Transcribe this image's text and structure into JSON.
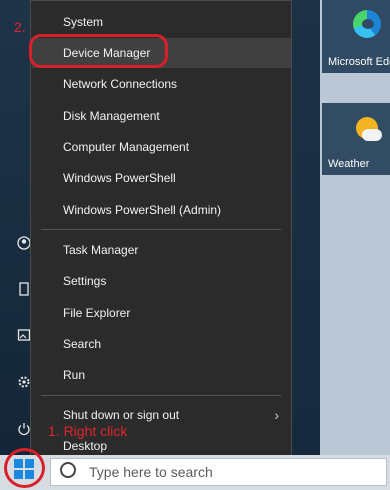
{
  "start_menu": {
    "items": [
      {
        "label": "System"
      },
      {
        "label": "Device Manager"
      },
      {
        "label": "Network Connections"
      },
      {
        "label": "Disk Management"
      },
      {
        "label": "Computer Management"
      },
      {
        "label": "Windows PowerShell"
      },
      {
        "label": "Windows PowerShell (Admin)"
      },
      {
        "label": "Task Manager"
      },
      {
        "label": "Settings"
      },
      {
        "label": "File Explorer"
      },
      {
        "label": "Search"
      },
      {
        "label": "Run"
      },
      {
        "label": "Shut down or sign out"
      },
      {
        "label": "Desktop"
      }
    ]
  },
  "tiles": {
    "edge_label": "Microsoft Edge",
    "weather_label": "Weather"
  },
  "taskbar": {
    "search_placeholder": "Type here to search"
  },
  "annotations": {
    "step1": "1. Right click",
    "step2": "2."
  },
  "colors": {
    "annotation": "#e0262b",
    "menu_background": "#2b2b2b",
    "menu_highlight": "#404040",
    "windows_blue": "#1a88e0"
  },
  "icons": {
    "sidebar": [
      "user-icon",
      "document-icon",
      "pictures-icon",
      "settings-icon",
      "power-icon"
    ],
    "start": "windows-logo-icon",
    "search": "search-icon",
    "submenu": "chevron-right-icon"
  }
}
